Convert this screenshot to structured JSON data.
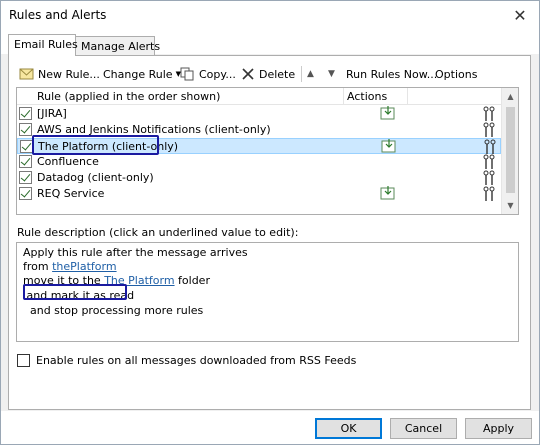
{
  "window": {
    "title": "Rules and Alerts",
    "close_glyph": "✕"
  },
  "tabs": [
    {
      "label": "Email Rules"
    },
    {
      "label": "Manage Alerts"
    }
  ],
  "toolbar": {
    "new_rule": "New Rule...",
    "change_rule": "Change Rule",
    "copy": "Copy...",
    "delete": "Delete",
    "run_rules_now": "Run Rules Now...",
    "options": "Options"
  },
  "rules_table": {
    "col_rule": "Rule (applied in the order shown)",
    "col_actions": "Actions",
    "rows": [
      {
        "name": "[JIRA]",
        "checked": true,
        "action_icon": true
      },
      {
        "name": "AWS and Jenkins Notifications  (client-only)",
        "checked": true,
        "action_icon": false
      },
      {
        "name": "The Platform  (client-only)",
        "checked": true,
        "action_icon": true,
        "selected": true
      },
      {
        "name": "Confluence",
        "checked": true,
        "action_icon": false
      },
      {
        "name": "Datadog  (client-only)",
        "checked": true,
        "action_icon": false
      },
      {
        "name": "REQ Service",
        "checked": true,
        "action_icon": true
      }
    ]
  },
  "description": {
    "label": "Rule description (click an underlined value to edit):",
    "line1": "Apply this rule after the message arrives",
    "line2_prefix": "from ",
    "line2_link": "thePlatform",
    "line3_prefix": "move it to the ",
    "line3_link": "The Platform",
    "line3_suffix": " folder",
    "line4": " and mark it as read",
    "line5": "  and stop processing more rules"
  },
  "rss_checkbox": {
    "label": "Enable rules on all messages downloaded from RSS Feeds",
    "checked": false
  },
  "buttons": {
    "ok": "OK",
    "cancel": "Cancel",
    "apply": "Apply"
  },
  "colors": {
    "selection": "#cce8ff",
    "link": "#1f5fa6",
    "annotation": "#1a1aa0",
    "ok_border": "#0078d7"
  }
}
